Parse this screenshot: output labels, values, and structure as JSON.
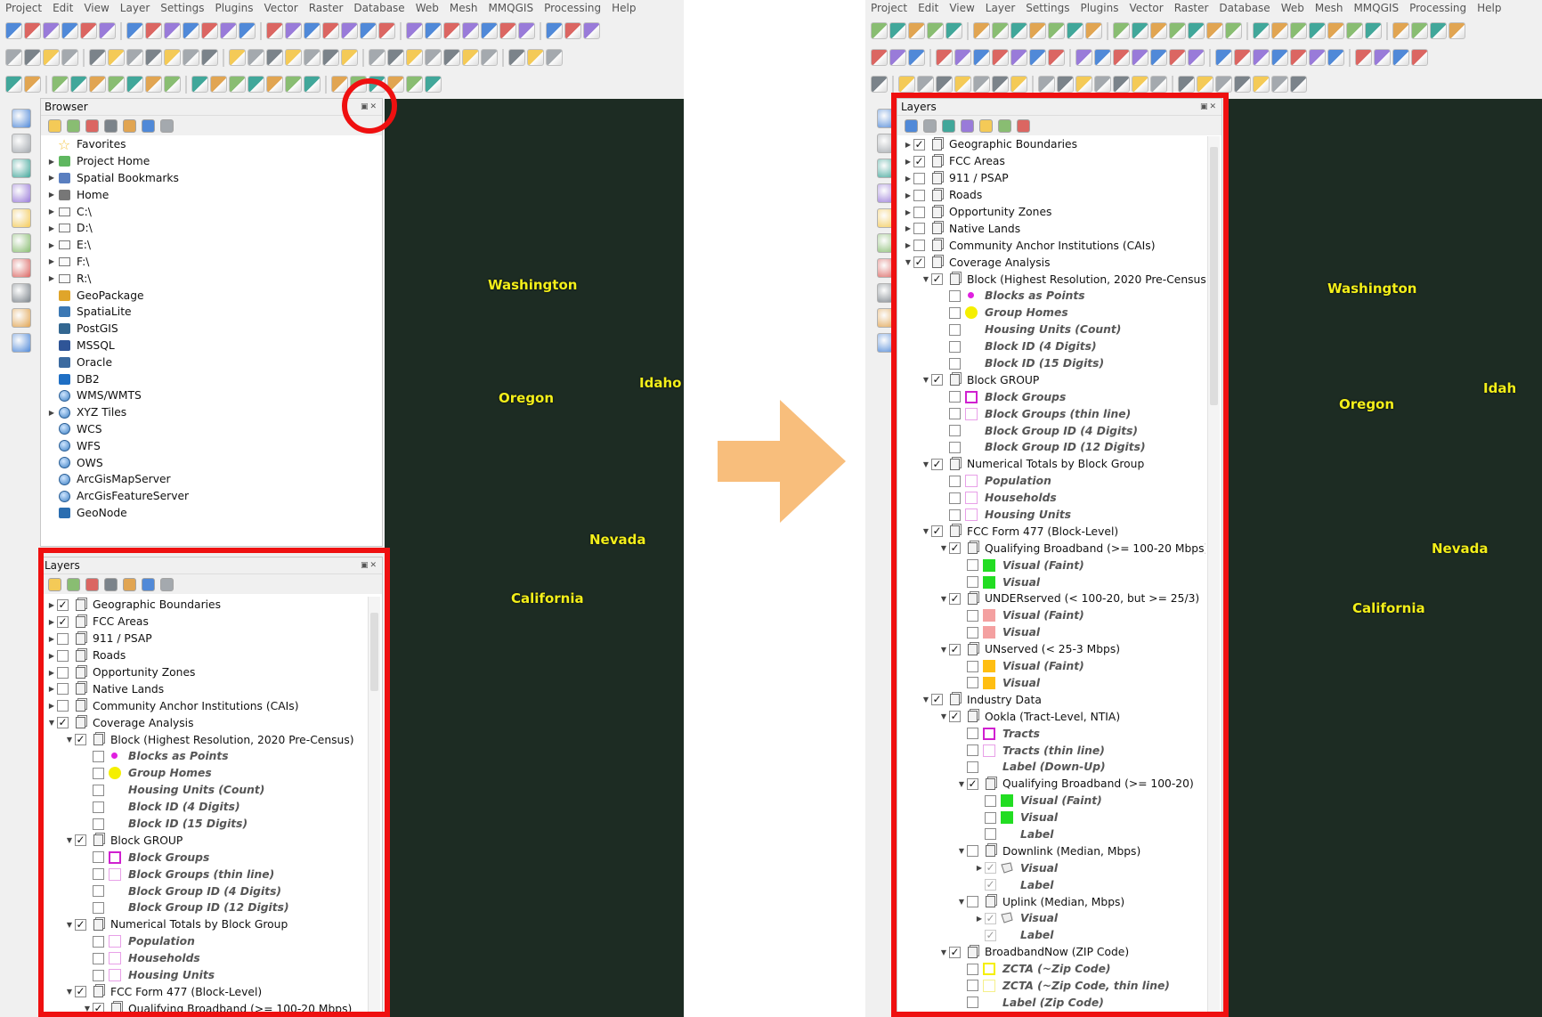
{
  "menu": [
    "Project",
    "Edit",
    "View",
    "Layer",
    "Settings",
    "Plugins",
    "Vector",
    "Raster",
    "Database",
    "Web",
    "Mesh",
    "MMQGIS",
    "Processing",
    "Help"
  ],
  "browser": {
    "title": "Browser",
    "items": [
      {
        "label": "Favorites",
        "icon": "star-icon",
        "expand": false
      },
      {
        "label": "Project Home",
        "icon": "folder-home-icon",
        "expand": true
      },
      {
        "label": "Spatial Bookmarks",
        "icon": "bookmark-icon",
        "expand": true
      },
      {
        "label": "Home",
        "icon": "home-folder-icon",
        "expand": true
      },
      {
        "label": "C:\\",
        "icon": "drive-icon",
        "expand": true
      },
      {
        "label": "D:\\",
        "icon": "drive-icon",
        "expand": true
      },
      {
        "label": "E:\\",
        "icon": "drive-icon",
        "expand": true
      },
      {
        "label": "F:\\",
        "icon": "drive-icon",
        "expand": true
      },
      {
        "label": "R:\\",
        "icon": "drive-icon",
        "expand": true
      },
      {
        "label": "GeoPackage",
        "icon": "geopackage-icon",
        "expand": false
      },
      {
        "label": "SpatiaLite",
        "icon": "spatialite-icon",
        "expand": false
      },
      {
        "label": "PostGIS",
        "icon": "postgis-icon",
        "expand": false
      },
      {
        "label": "MSSQL",
        "icon": "mssql-icon",
        "expand": false
      },
      {
        "label": "Oracle",
        "icon": "oracle-icon",
        "expand": false
      },
      {
        "label": "DB2",
        "icon": "db2-icon",
        "expand": false
      },
      {
        "label": "WMS/WMTS",
        "icon": "globe-icon",
        "expand": false
      },
      {
        "label": "XYZ Tiles",
        "icon": "globe-icon",
        "expand": true
      },
      {
        "label": "WCS",
        "icon": "globe-icon",
        "expand": false
      },
      {
        "label": "WFS",
        "icon": "globe-icon",
        "expand": false
      },
      {
        "label": "OWS",
        "icon": "globe-icon",
        "expand": false
      },
      {
        "label": "ArcGisMapServer",
        "icon": "globe-icon",
        "expand": false
      },
      {
        "label": "ArcGisFeatureServer",
        "icon": "globe-icon",
        "expand": false
      },
      {
        "label": "GeoNode",
        "icon": "geonode-icon",
        "expand": false
      }
    ]
  },
  "layers_title": "Layers",
  "layers": [
    {
      "label": "Geographic Boundaries",
      "lvl": 0,
      "arrow": "r",
      "chk": true,
      "ico": "group"
    },
    {
      "label": "FCC Areas",
      "lvl": 0,
      "arrow": "r",
      "chk": true,
      "ico": "group"
    },
    {
      "label": "911 / PSAP",
      "lvl": 0,
      "arrow": "r",
      "chk": false,
      "ico": "group"
    },
    {
      "label": "Roads",
      "lvl": 0,
      "arrow": "r",
      "chk": false,
      "ico": "group"
    },
    {
      "label": "Opportunity Zones",
      "lvl": 0,
      "arrow": "r",
      "chk": false,
      "ico": "group"
    },
    {
      "label": "Native Lands",
      "lvl": 0,
      "arrow": "r",
      "chk": false,
      "ico": "group"
    },
    {
      "label": "Community Anchor Institutions (CAIs)",
      "lvl": 0,
      "arrow": "r",
      "chk": false,
      "ico": "group"
    },
    {
      "label": "Coverage Analysis",
      "lvl": 0,
      "arrow": "d",
      "chk": true,
      "ico": "group"
    },
    {
      "label": "Block (Highest Resolution, 2020 Pre-Census)",
      "lvl": 1,
      "arrow": "d",
      "chk": true,
      "ico": "group"
    },
    {
      "label": "Blocks as Points",
      "lvl": 2,
      "chk": false,
      "sw": "dot",
      "c": "#e020e0",
      "it": true
    },
    {
      "label": "Group Homes",
      "lvl": 2,
      "chk": false,
      "sw": "bigdot",
      "c": "#f5ef00",
      "it": true
    },
    {
      "label": "Housing Units (Count)",
      "lvl": 2,
      "chk": false,
      "sw": "none",
      "it": true
    },
    {
      "label": "Block ID (4 Digits)",
      "lvl": 2,
      "chk": false,
      "sw": "none",
      "it": true
    },
    {
      "label": "Block ID (15 Digits)",
      "lvl": 2,
      "chk": false,
      "sw": "none",
      "it": true
    },
    {
      "label": "Block GROUP",
      "lvl": 1,
      "arrow": "d",
      "chk": true,
      "ico": "group"
    },
    {
      "label": "Block Groups",
      "lvl": 2,
      "chk": false,
      "sw": "outline",
      "c": "#d020d0",
      "it": true
    },
    {
      "label": "Block Groups (thin line)",
      "lvl": 2,
      "chk": false,
      "sw": "thin",
      "c": "#e8a0e8",
      "it": true
    },
    {
      "label": "Block Group ID (4 Digits)",
      "lvl": 2,
      "chk": false,
      "sw": "none",
      "it": true
    },
    {
      "label": "Block Group ID (12 Digits)",
      "lvl": 2,
      "chk": false,
      "sw": "none",
      "it": true
    },
    {
      "label": "Numerical Totals by Block Group",
      "lvl": 1,
      "arrow": "d",
      "chk": true,
      "ico": "group"
    },
    {
      "label": "Population",
      "lvl": 2,
      "chk": false,
      "sw": "thin",
      "c": "#e8a0e8",
      "it": true
    },
    {
      "label": "Households",
      "lvl": 2,
      "chk": false,
      "sw": "thin",
      "c": "#e8a0e8",
      "it": true
    },
    {
      "label": "Housing Units",
      "lvl": 2,
      "chk": false,
      "sw": "thin",
      "c": "#e8a0e8",
      "it": true
    },
    {
      "label": "FCC Form 477 (Block-Level)",
      "lvl": 1,
      "arrow": "d",
      "chk": true,
      "ico": "group"
    },
    {
      "label": "Qualifying Broadband (>= 100-20 Mbps)",
      "lvl": 2,
      "arrow": "d",
      "chk": true,
      "ico": "group"
    },
    {
      "label": "Visual (Faint)",
      "lvl": 3,
      "chk": false,
      "sw": "fill",
      "c": "#22dd22",
      "it": true
    },
    {
      "label": "Visual",
      "lvl": 3,
      "chk": false,
      "sw": "fill",
      "c": "#22dd22",
      "it": true
    },
    {
      "label": "UNDERserved (< 100-20, but >= 25/3)",
      "lvl": 2,
      "arrow": "d",
      "chk": true,
      "ico": "group"
    },
    {
      "label": "Visual (Faint)",
      "lvl": 3,
      "chk": false,
      "sw": "fill",
      "c": "#f4a0a0",
      "it": true
    },
    {
      "label": "Visual",
      "lvl": 3,
      "chk": false,
      "sw": "fill",
      "c": "#f4a0a0",
      "it": true
    },
    {
      "label": "UNserved (< 25-3 Mbps)",
      "lvl": 2,
      "arrow": "d",
      "chk": true,
      "ico": "group"
    },
    {
      "label": "Visual (Faint)",
      "lvl": 3,
      "chk": false,
      "sw": "fill",
      "c": "#ffbe12",
      "it": true
    },
    {
      "label": "Visual",
      "lvl": 3,
      "chk": false,
      "sw": "fill",
      "c": "#ffbe12",
      "it": true
    },
    {
      "label": "Industry Data",
      "lvl": 1,
      "arrow": "d",
      "chk": true,
      "ico": "group"
    },
    {
      "label": "Ookla (Tract-Level, NTIA)",
      "lvl": 2,
      "arrow": "d",
      "chk": true,
      "ico": "group"
    },
    {
      "label": "Tracts",
      "lvl": 3,
      "chk": false,
      "sw": "outline",
      "c": "#d020d0",
      "it": true
    },
    {
      "label": "Tracts (thin line)",
      "lvl": 3,
      "chk": false,
      "sw": "thin",
      "c": "#e8a0e8",
      "it": true
    },
    {
      "label": "Label (Down-Up)",
      "lvl": 3,
      "chk": false,
      "sw": "none",
      "it": true
    },
    {
      "label": "Qualifying Broadband (>= 100-20)",
      "lvl": 3,
      "arrow": "d",
      "chk": true,
      "ico": "group"
    },
    {
      "label": "Visual (Faint)",
      "lvl": 4,
      "chk": false,
      "sw": "fill",
      "c": "#22dd22",
      "it": true
    },
    {
      "label": "Visual",
      "lvl": 4,
      "chk": false,
      "sw": "fill",
      "c": "#22dd22",
      "it": true
    },
    {
      "label": "Label",
      "lvl": 4,
      "chk": false,
      "sw": "none",
      "it": true
    },
    {
      "label": "Downlink (Median, Mbps)",
      "lvl": 3,
      "arrow": "d",
      "chk": false,
      "ico": "group"
    },
    {
      "label": "Visual",
      "lvl": 4,
      "arrow": "r",
      "chk": true,
      "dim": true,
      "sw": "poly",
      "it": true
    },
    {
      "label": "Label",
      "lvl": 4,
      "chk": true,
      "dim": true,
      "sw": "none",
      "it": true
    },
    {
      "label": "Uplink (Median, Mbps)",
      "lvl": 3,
      "arrow": "d",
      "chk": false,
      "ico": "group"
    },
    {
      "label": "Visual",
      "lvl": 4,
      "arrow": "r",
      "chk": true,
      "dim": true,
      "sw": "poly",
      "it": true
    },
    {
      "label": "Label",
      "lvl": 4,
      "chk": true,
      "dim": true,
      "sw": "none",
      "it": true
    },
    {
      "label": "BroadbandNow (ZIP Code)",
      "lvl": 2,
      "arrow": "d",
      "chk": true,
      "ico": "group"
    },
    {
      "label": "ZCTA (~Zip Code)",
      "lvl": 3,
      "chk": false,
      "sw": "outline",
      "c": "#f5ef00",
      "it": true
    },
    {
      "label": "ZCTA (~Zip Code, thin line)",
      "lvl": 3,
      "chk": false,
      "sw": "thin",
      "c": "#f6f08a",
      "it": true
    },
    {
      "label": "Label (Zip Code)",
      "lvl": 3,
      "chk": false,
      "sw": "none",
      "it": true
    }
  ],
  "states": {
    "washington": "Washington",
    "oregon": "Oregon",
    "idaho_left": "Idaho",
    "idaho_right": "Idah",
    "nevada": "Nevada",
    "california": "California"
  },
  "colors": {
    "highlight": "#ef1010",
    "arrow": "#f8be7c",
    "boundary": "#e020e0",
    "state_label": "#f3ef1a"
  }
}
